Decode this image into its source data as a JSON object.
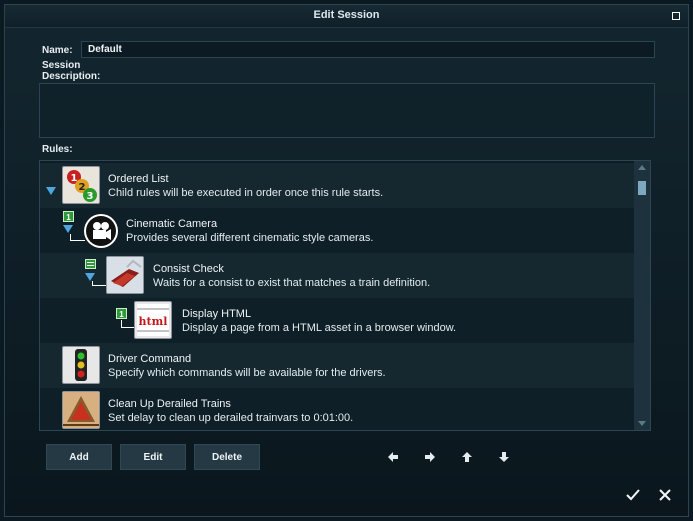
{
  "dialog": {
    "title": "Edit Session"
  },
  "form": {
    "name_label": "Name:",
    "name_value": "Default",
    "session_description_label_line1": "Session",
    "session_description_label_line2": "Description:",
    "rules_label": "Rules:"
  },
  "rules": [
    {
      "title": "Ordered List",
      "description": "Child rules will be executed in order once this rule starts.",
      "icon": "ordered-list-icon"
    },
    {
      "title": "Cinematic Camera",
      "description": "Provides several different cinematic style cameras.",
      "icon": "cinematic-camera-icon",
      "badge": "1"
    },
    {
      "title": "Consist Check",
      "description": "Waits for a consist to exist that matches a train definition.",
      "icon": "consist-check-icon"
    },
    {
      "title": "Display HTML",
      "description": "Display a page from a HTML asset in a browser window.",
      "icon": "display-html-icon",
      "badge": "1"
    },
    {
      "title": "Driver Command",
      "description": "Specify which commands will be available for the drivers.",
      "icon": "traffic-light-icon"
    },
    {
      "title": "Clean Up Derailed Trains",
      "description": "Set delay to clean up derailed trainvars to 0:01:00.",
      "icon": "derailed-trains-icon"
    }
  ],
  "buttons": {
    "add": "Add",
    "edit": "Edit",
    "delete": "Delete"
  },
  "icons": {
    "move_left": "arrow-left-icon",
    "move_right": "arrow-right-icon",
    "move_up": "arrow-up-icon",
    "move_down": "arrow-down-icon",
    "ok": "checkmark-icon",
    "cancel": "close-x-icon"
  },
  "colors": {
    "accent_blue": "#4fa6e0",
    "badge_green": "#2f9a3a"
  }
}
